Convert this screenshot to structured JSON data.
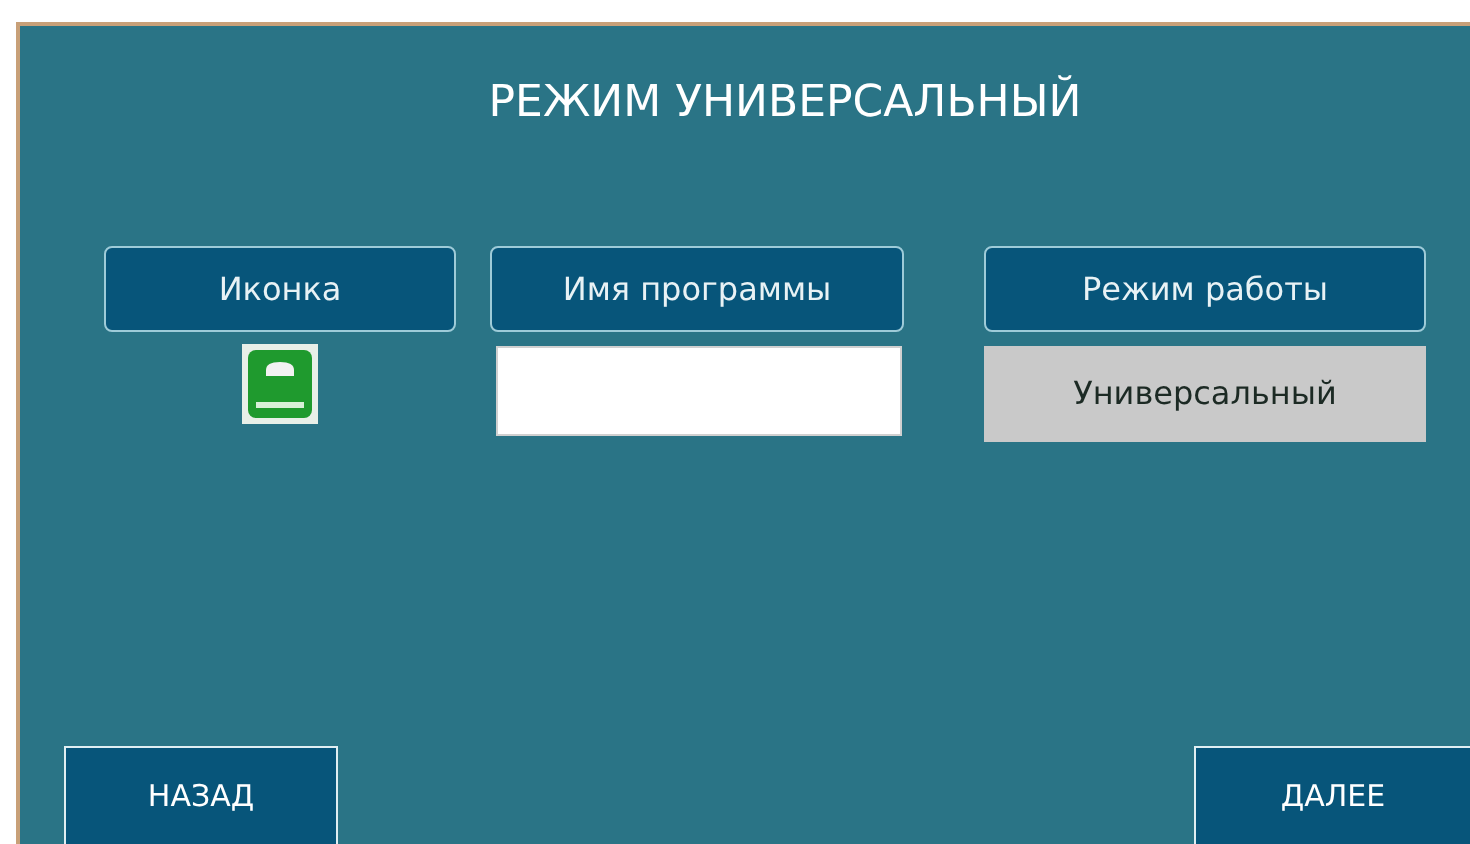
{
  "title": "РЕЖИМ УНИВЕРСАЛЬНЫЙ",
  "columns": [
    {
      "header": "Иконка",
      "kind": "icon"
    },
    {
      "header": "Имя программы",
      "kind": "field"
    },
    {
      "header": "Режим работы",
      "kind": "value",
      "value": "Универсальный"
    }
  ],
  "buttons": {
    "back": "НАЗАД",
    "next": "ДАЛЕЕ"
  }
}
